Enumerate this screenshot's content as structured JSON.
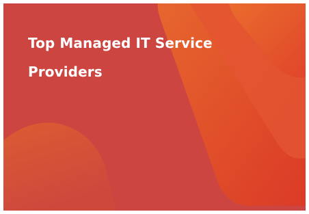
{
  "card": {
    "title": "Top Managed IT Service Providers",
    "background_color": "#cc4541",
    "accent_color_light": "#e8642e",
    "accent_color_dark": "#de3524",
    "title_color": "#ffffff"
  }
}
